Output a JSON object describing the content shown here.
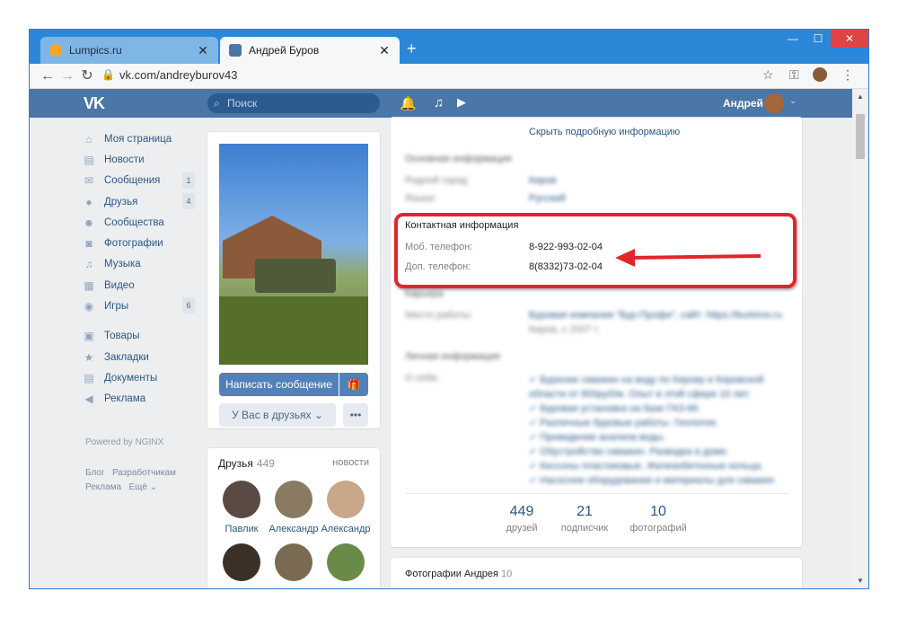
{
  "browser": {
    "tabs": [
      {
        "title": "Lumpics.ru",
        "close": "✕",
        "favicon_color": "#f5a623"
      },
      {
        "title": "Андрей Буров",
        "close": "✕",
        "favicon_color": "#4a76a8"
      }
    ],
    "new_tab": "+",
    "window_buttons": {
      "minimize": "—",
      "maximize": "☐",
      "close": "✕"
    },
    "url": "vk.com/andreyburov43"
  },
  "vk": {
    "logo": "VK",
    "search_placeholder": "Поиск",
    "user_name": "Андрей",
    "accent": "#4a76a8"
  },
  "menu": [
    {
      "label": "Моя страница",
      "icon": "home-icon",
      "glyph": "⌂",
      "badge": ""
    },
    {
      "label": "Новости",
      "icon": "news-icon",
      "glyph": "▤",
      "badge": ""
    },
    {
      "label": "Сообщения",
      "icon": "messages-icon",
      "glyph": "✉",
      "badge": "1"
    },
    {
      "label": "Друзья",
      "icon": "friends-icon",
      "glyph": "●",
      "badge": "4"
    },
    {
      "label": "Сообщества",
      "icon": "communities-icon",
      "glyph": "☻",
      "badge": ""
    },
    {
      "label": "Фотографии",
      "icon": "camera-icon",
      "glyph": "◙",
      "badge": ""
    },
    {
      "label": "Музыка",
      "icon": "music-icon",
      "glyph": "♫",
      "badge": ""
    },
    {
      "label": "Видео",
      "icon": "video-icon",
      "glyph": "▦",
      "badge": ""
    },
    {
      "label": "Игры",
      "icon": "games-icon",
      "glyph": "◉",
      "badge": "6"
    }
  ],
  "menu2": [
    {
      "label": "Товары",
      "icon": "bag-icon",
      "glyph": "▣"
    },
    {
      "label": "Закладки",
      "icon": "star-icon",
      "glyph": "★"
    },
    {
      "label": "Документы",
      "icon": "document-icon",
      "glyph": "▤"
    },
    {
      "label": "Реклама",
      "icon": "megaphone-icon",
      "glyph": "◀"
    }
  ],
  "footer": {
    "powered": "Powered by NGINX",
    "blog": "Блог",
    "developers": "Разработчикам",
    "ads": "Реклама",
    "more": "Ещё ⌄"
  },
  "profile": {
    "write_message": "Написать сообщение",
    "gift": "🎁",
    "in_friends": "У Вас в друзьях ⌄",
    "more": "•••"
  },
  "friends": {
    "title": "Друзья",
    "count": "449",
    "news": "новости",
    "list": [
      {
        "name": "Павлик",
        "color": "#5a4a44"
      },
      {
        "name": "Александр",
        "color": "#8a7a62"
      },
      {
        "name": "Александр",
        "color": "#c9a88a"
      }
    ]
  },
  "info": {
    "hide_details": "Скрыть подробную информацию",
    "basic_title": "Основная информация",
    "hometown_label": "Родной город:",
    "hometown": "Киров",
    "languages_label": "Языки:",
    "languages": "Русский",
    "contact_title": "Контактная информация",
    "mobile_label": "Моб. телефон:",
    "mobile": "8-922-993-02-04",
    "alt_label": "Доп. телефон:",
    "alt": "8(8332)73-02-04",
    "career_title": "Карьера",
    "work_label": "Место работы:",
    "work_line1": "Буровая компания \"Бур-Профи\", сайт: https://burkirov.ru",
    "work_line2": "Киров, с 2007 г.",
    "personal_title": "Личная информация",
    "about_label": "О себе:",
    "about_lines": [
      "✓ Бурение скважин на воду по Кирову и Кировской",
      "области от 800руб/м. Опыт в этой сфере 10 лет.",
      "✓ Буровая установка на базе ГАЗ-66.",
      "✓ Различные буровые работы. Геология.",
      "✓ Проведение анализа воды.",
      "✓ Обустройство скважин. Разводка в доме.",
      "✓ Кессоны пластиковые. Железобетонные кольца.",
      "✓ Насосное оборудование и материалы для скважин"
    ]
  },
  "stats": [
    {
      "n": "449",
      "l": "друзей"
    },
    {
      "n": "21",
      "l": "подписчик"
    },
    {
      "n": "10",
      "l": "фотографий"
    }
  ],
  "photos_block": {
    "title": "Фотографии Андрея",
    "count": "10"
  }
}
